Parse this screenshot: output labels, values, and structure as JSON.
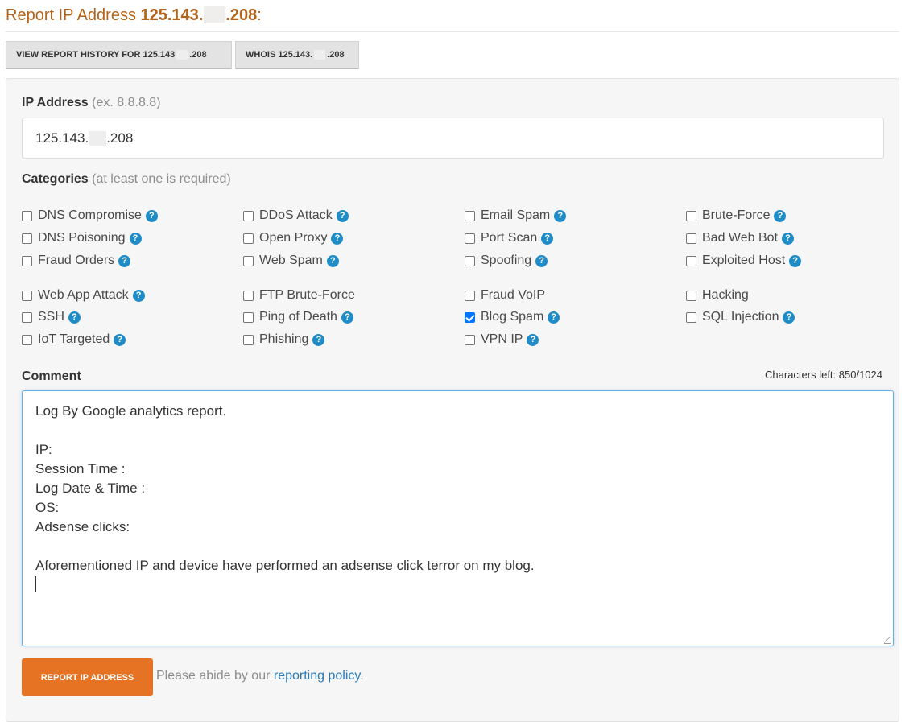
{
  "title": {
    "prefix": "Report IP Address ",
    "ip_start": "125.143.",
    "ip_end": ".208",
    "suffix": ":"
  },
  "buttons": {
    "history_label_a": "VIEW REPORT HISTORY FOR 125.143",
    "history_label_b": ".208",
    "whois_label_a": "WHOIS 125.143.",
    "whois_label_b": ".208"
  },
  "ip_field": {
    "label": "IP Address",
    "hint": "(ex. 8.8.8.8)",
    "value_start": "125.143.",
    "value_end": ".208"
  },
  "categories": {
    "label": "Categories",
    "hint": "(at least one is required)",
    "help_icon": "question-circle-icon",
    "items": [
      {
        "label": "DNS Compromise",
        "checked": false,
        "help": true
      },
      {
        "label": "DDoS Attack",
        "checked": false,
        "help": true
      },
      {
        "label": "Email Spam",
        "checked": false,
        "help": true
      },
      {
        "label": "Brute-Force",
        "checked": false,
        "help": true
      },
      {
        "label": "DNS Poisoning",
        "checked": false,
        "help": true
      },
      {
        "label": "Open Proxy",
        "checked": false,
        "help": true
      },
      {
        "label": "Port Scan",
        "checked": false,
        "help": true
      },
      {
        "label": "Bad Web Bot",
        "checked": false,
        "help": true
      },
      {
        "label": "Fraud Orders",
        "checked": false,
        "help": true
      },
      {
        "label": "Web Spam",
        "checked": false,
        "help": true
      },
      {
        "label": "Spoofing",
        "checked": false,
        "help": true
      },
      {
        "label": "Exploited Host",
        "checked": false,
        "help": true
      },
      {
        "label": "Web App Attack",
        "checked": false,
        "help": true
      },
      {
        "label": "FTP Brute-Force",
        "checked": false,
        "help": false
      },
      {
        "label": "Fraud VoIP",
        "checked": false,
        "help": false
      },
      {
        "label": "Hacking",
        "checked": false,
        "help": false
      },
      {
        "label": "SSH",
        "checked": false,
        "help": true
      },
      {
        "label": "Ping of Death",
        "checked": false,
        "help": true
      },
      {
        "label": "Blog Spam",
        "checked": true,
        "help": true
      },
      {
        "label": "SQL Injection",
        "checked": false,
        "help": true
      },
      {
        "label": "IoT Targeted",
        "checked": false,
        "help": true
      },
      {
        "label": "Phishing",
        "checked": false,
        "help": true
      },
      {
        "label": "VPN IP",
        "checked": false,
        "help": true
      }
    ]
  },
  "comment": {
    "label": "Comment",
    "chars_left": "Characters left: 850/1024",
    "lines": [
      "Log By Google analytics report.",
      "",
      "IP:",
      "Session Time :",
      "Log Date & Time :",
      "OS:",
      "Adsense clicks:",
      "",
      "Aforementioned IP and device have performed an adsense click terror on my blog."
    ]
  },
  "footer": {
    "submit_label": "REPORT IP ADDRESS",
    "policy_prefix": "Please abide by our ",
    "policy_link": "reporting policy",
    "policy_suffix": "."
  },
  "colors": {
    "title": "#b4631a",
    "submit": "#e67324",
    "link": "#2a7ab8",
    "help_icon": "#1f8cc8",
    "checkbox_checked": "#0075ff"
  }
}
